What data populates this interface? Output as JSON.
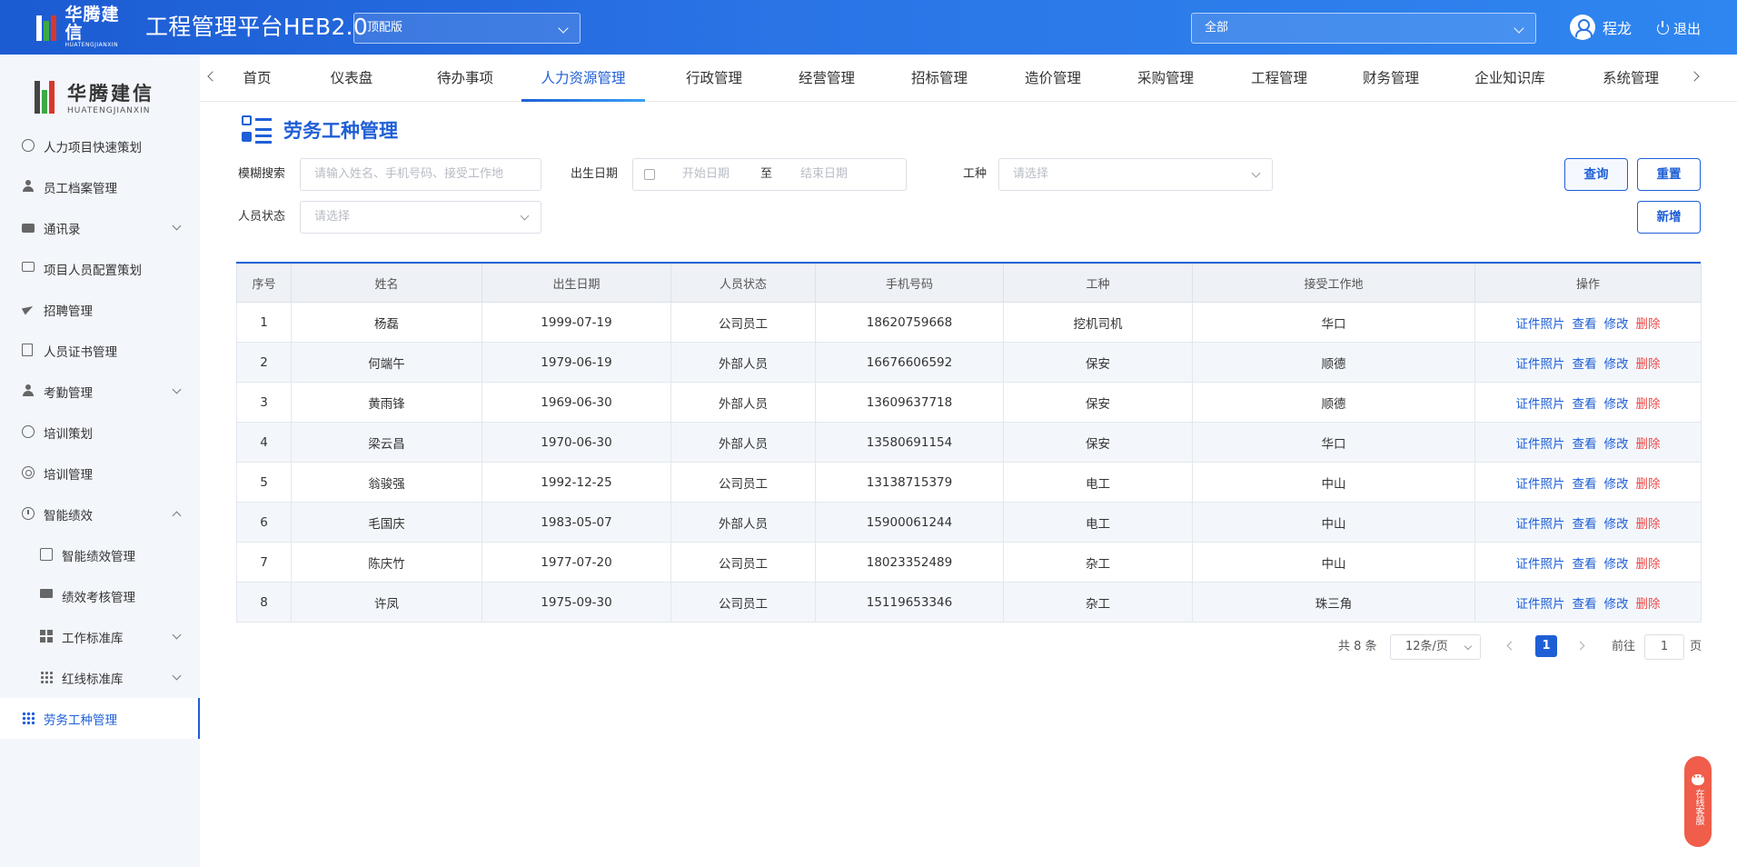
{
  "header": {
    "logo_cn": "华腾建信",
    "logo_en": "HUATENGJIANXIN",
    "app_title": "工程管理平台HEB2.0",
    "edition_select": "顶配版",
    "scope_select": "全部",
    "user_name": "程龙",
    "logout_label": "退出"
  },
  "sidebar": {
    "logo_cn": "华腾建信",
    "logo_en": "HUATENGJIANXIN",
    "items": [
      {
        "label": "人力项目快速策划"
      },
      {
        "label": "员工档案管理"
      },
      {
        "label": "通讯录"
      },
      {
        "label": "项目人员配置策划"
      },
      {
        "label": "招聘管理"
      },
      {
        "label": "人员证书管理"
      },
      {
        "label": "考勤管理"
      },
      {
        "label": "培训策划"
      },
      {
        "label": "培训管理"
      },
      {
        "label": "智能绩效"
      },
      {
        "label": "智能绩效管理"
      },
      {
        "label": "绩效考核管理"
      },
      {
        "label": "工作标准库"
      },
      {
        "label": "红线标准库"
      },
      {
        "label": "劳务工种管理"
      }
    ]
  },
  "tabs": [
    "首页",
    "仪表盘",
    "待办事项",
    "人力资源管理",
    "行政管理",
    "经营管理",
    "招标管理",
    "造价管理",
    "采购管理",
    "工程管理",
    "财务管理",
    "企业知识库",
    "系统管理"
  ],
  "page": {
    "title": "劳务工种管理"
  },
  "filters": {
    "fuzzy_label": "模糊搜索",
    "fuzzy_placeholder": "请输入姓名、手机号码、接受工作地",
    "birth_label": "出生日期",
    "start_placeholder": "开始日期",
    "range_sep": "至",
    "end_placeholder": "结束日期",
    "trade_label": "工种",
    "trade_placeholder": "请选择",
    "status_label": "人员状态",
    "status_placeholder": "请选择",
    "query_btn": "查询",
    "reset_btn": "重置",
    "add_btn": "新增"
  },
  "table": {
    "headers": [
      "序号",
      "姓名",
      "出生日期",
      "人员状态",
      "手机号码",
      "工种",
      "接受工作地",
      "操作"
    ],
    "actions": [
      "证件照片",
      "查看",
      "修改",
      "删除"
    ],
    "rows": [
      [
        "1",
        "杨磊",
        "1999-07-19",
        "公司员工",
        "18620759668",
        "挖机司机",
        "华口"
      ],
      [
        "2",
        "何端午",
        "1979-06-19",
        "外部人员",
        "16676606592",
        "保安",
        "顺德"
      ],
      [
        "3",
        "黄雨锋",
        "1969-06-30",
        "外部人员",
        "13609637718",
        "保安",
        "顺德"
      ],
      [
        "4",
        "梁云昌",
        "1970-06-30",
        "外部人员",
        "13580691154",
        "保安",
        "华口"
      ],
      [
        "5",
        "翁骏强",
        "1992-12-25",
        "公司员工",
        "13138715379",
        "电工",
        "中山"
      ],
      [
        "6",
        "毛国庆",
        "1983-05-07",
        "外部人员",
        "15900061244",
        "电工",
        "中山"
      ],
      [
        "7",
        "陈庆竹",
        "1977-07-20",
        "公司员工",
        "18023352489",
        "杂工",
        "中山"
      ],
      [
        "8",
        "许凤",
        "1975-09-30",
        "公司员工",
        "15119653346",
        "杂工",
        "珠三角"
      ]
    ]
  },
  "pagination": {
    "total": "共 8 条",
    "page_size": "12条/页",
    "current_page": "1",
    "goto_label": "前往",
    "goto_value": "1",
    "page_suffix": "页"
  },
  "chat_widget": {
    "label": "在线客服"
  },
  "colors": {
    "accent": "#1f5fd6",
    "danger": "#f04a4a",
    "header_gradient_start": "#1c5bd2",
    "header_gradient_end": "#2f86f0"
  }
}
